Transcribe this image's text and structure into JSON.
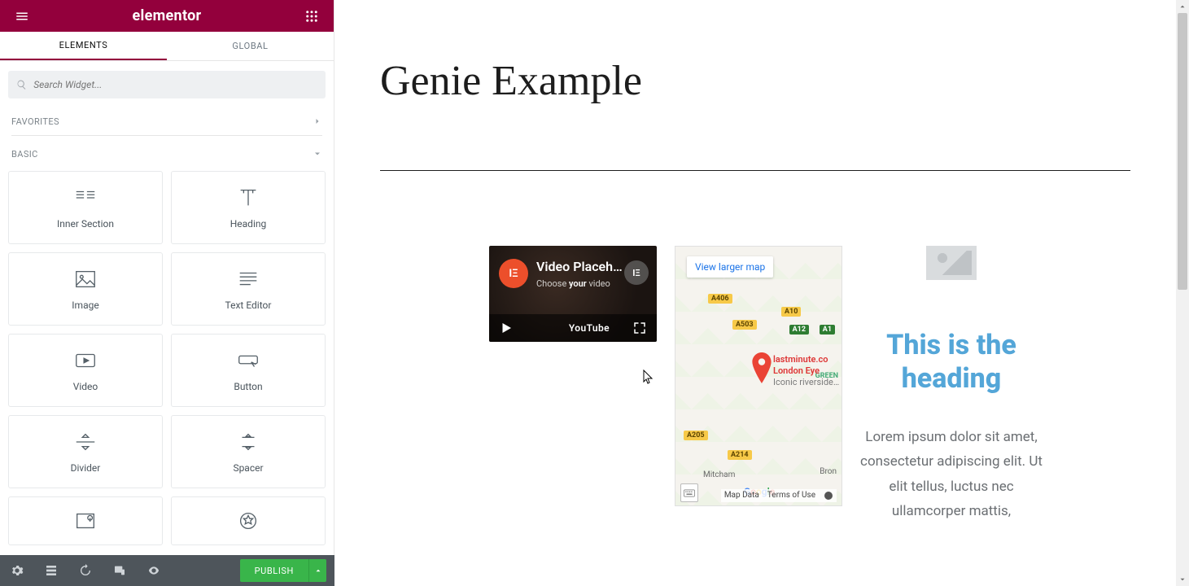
{
  "brand": "elementor",
  "tabs": {
    "elements": "ELEMENTS",
    "global": "GLOBAL"
  },
  "search": {
    "placeholder": "Search Widget..."
  },
  "sections": {
    "favorites": "FAVORITES",
    "basic": "BASIC"
  },
  "widgets": {
    "inner_section": "Inner Section",
    "heading": "Heading",
    "image": "Image",
    "text_editor": "Text Editor",
    "video": "Video",
    "button": "Button",
    "divider": "Divider",
    "spacer": "Spacer"
  },
  "footer": {
    "publish": "PUBLISH"
  },
  "page": {
    "title": "Genie Example"
  },
  "video": {
    "avatar_initials": "IΞ",
    "title": "Video Placeh…",
    "subtitle_prefix": "Choose ",
    "subtitle_bold": "your",
    "subtitle_suffix": " video",
    "edit_initials": "IΞ",
    "youtube_label": "YouTube"
  },
  "map": {
    "view_larger": "View larger map",
    "place_line1": "lastminute.co",
    "place_line2": "London Eye",
    "place_line3": "Iconic riverside…",
    "roads": {
      "a1": "A1",
      "a12": "A12",
      "a406": "A406",
      "a503": "A503",
      "a10": "A10",
      "a205": "A205",
      "a214": "A214",
      "green": "GREEN"
    },
    "google": [
      "G",
      "o",
      "o",
      "g",
      "l",
      "e"
    ],
    "map_data": "Map Data",
    "terms": "Terms of Use",
    "mitcham": "Mitcham",
    "bron": "Bron"
  },
  "content": {
    "heading": "This is the heading",
    "body": "Lorem ipsum dolor sit amet, consectetur adipiscing elit. Ut elit tellus, luctus nec ullamcorper mattis,"
  }
}
